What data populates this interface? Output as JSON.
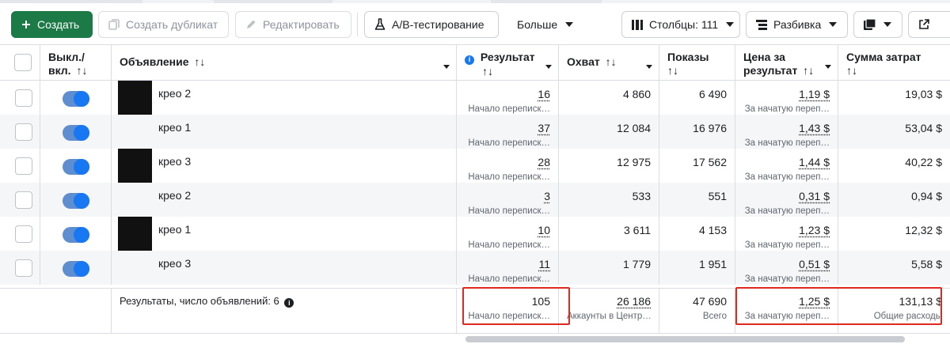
{
  "toolbar": {
    "create": "Создать",
    "duplicate": "Создать дубликат",
    "edit": "Редактировать",
    "ab_test": "A/B-тестирование",
    "more": "Больше",
    "columns": "Столбцы: 111",
    "breakdown": "Разбивка"
  },
  "columns": {
    "toggle": "Выкл./ вкл.",
    "ad": "Объявление",
    "result": "Результат",
    "reach": "Охват",
    "impressions": "Показы",
    "cost_per_result": "Цена за результат",
    "amount_spent": "Сумма затрат",
    "sort_glyph": "↑↓"
  },
  "rows": [
    {
      "name": "крео 2",
      "result": "16",
      "result_sub": "Начало переписк…",
      "reach": "4 860",
      "impressions": "6 490",
      "cpr": "1,19 $",
      "cpr_sub": "За начатую переп…",
      "spent": "19,03 $"
    },
    {
      "name": "крео 1",
      "result": "37",
      "result_sub": "Начало переписк…",
      "reach": "12 084",
      "impressions": "16 976",
      "cpr": "1,43 $",
      "cpr_sub": "За начатую переп…",
      "spent": "53,04 $"
    },
    {
      "name": "крео 3",
      "result": "28",
      "result_sub": "Начало переписк…",
      "reach": "12 975",
      "impressions": "17 562",
      "cpr": "1,44 $",
      "cpr_sub": "За начатую переп…",
      "spent": "40,22 $"
    },
    {
      "name": "крео 2",
      "result": "3",
      "result_sub": "Начало переписк…",
      "reach": "533",
      "impressions": "551",
      "cpr": "0,31 $",
      "cpr_sub": "За начатую переп…",
      "spent": "0,94 $"
    },
    {
      "name": "крео 1",
      "result": "10",
      "result_sub": "Начало переписк…",
      "reach": "3 611",
      "impressions": "4 153",
      "cpr": "1,23 $",
      "cpr_sub": "За начатую переп…",
      "spent": "12,32 $"
    },
    {
      "name": "крео 3",
      "result": "11",
      "result_sub": "Начало переписк…",
      "reach": "1 779",
      "impressions": "1 951",
      "cpr": "0,51 $",
      "cpr_sub": "За начатую переп…",
      "spent": "5,58 $"
    }
  ],
  "totals": {
    "label": "Результаты, число объявлений: 6",
    "result": "105",
    "result_sub": "Начало переписк…",
    "reach": "26 186",
    "reach_sub": "Аккаунты в Центр…",
    "impressions": "47 690",
    "impressions_sub": "Всего",
    "cpr": "1,25 $",
    "cpr_sub": "За начатую переп…",
    "spent": "131,13 $",
    "spent_sub": "Общие расходы"
  },
  "colors": {
    "primary": "#1b7a46",
    "toggle_on": "#1877f2",
    "highlight": "#e0281f",
    "info_icon": "#1877f2"
  }
}
